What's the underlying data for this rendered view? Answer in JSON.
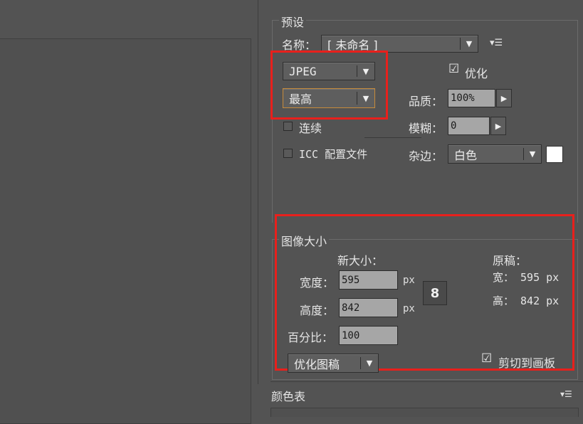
{
  "preset": {
    "legend": "预设",
    "name_label": "名称：",
    "name_value": "[ 未命名 ]",
    "menu_icon": "flyout-menu-icon",
    "format_value": "JPEG",
    "quality_level_value": "最高",
    "optimize_label": "优化",
    "optimize_checked": true,
    "quality_label": "品质：",
    "quality_value": "100%",
    "blur_label": "模糊：",
    "blur_value": "0",
    "continuous_label": "连续",
    "continuous_checked": false,
    "icc_label": "ICC 配置文件",
    "icc_checked": false,
    "matte_label": "杂边：",
    "matte_value": "白色",
    "matte_color": "#ffffff"
  },
  "image_size": {
    "legend": "图像大小",
    "new_size_label": "新大小：",
    "width_label": "宽度：",
    "width_value": "595",
    "width_unit": "px",
    "height_label": "高度：",
    "height_value": "842",
    "height_unit": "px",
    "percent_label": "百分比：",
    "percent_value": "100",
    "original_label": "原稿：",
    "original_width": "宽： 595 px",
    "original_height": "高： 842 px",
    "resample_value": "优化图稿",
    "clip_label": "剪切到画板",
    "clip_checked": true
  },
  "color_table": {
    "title": "颜色表"
  },
  "colors": {
    "highlight": "#e8201c",
    "panel_bg": "#535353"
  }
}
